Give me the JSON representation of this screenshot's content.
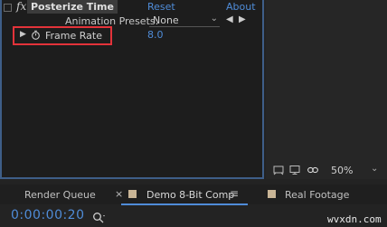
{
  "effect_controls": {
    "fx_badge": "fx",
    "effect_name": "Posterize Time",
    "reset_label": "Reset",
    "about_label": "About",
    "animation_presets_label": "Animation Presets:",
    "animation_presets_value": "None",
    "property": {
      "label": "Frame Rate",
      "value": "8.0"
    }
  },
  "viewer": {
    "zoom_value": "50%"
  },
  "timeline": {
    "tabs": [
      {
        "label": "Render Queue"
      },
      {
        "label": "Demo 8-Bit Comp"
      },
      {
        "label": "Real Footage"
      }
    ],
    "timecode": "0:00:00:20"
  },
  "watermark": "wvxdn.com",
  "colors": {
    "accent_blue": "#4f8cd8",
    "highlight_red": "#e3333a",
    "panel_border": "#3e5e88",
    "comp_swatch": "#c9b596"
  }
}
